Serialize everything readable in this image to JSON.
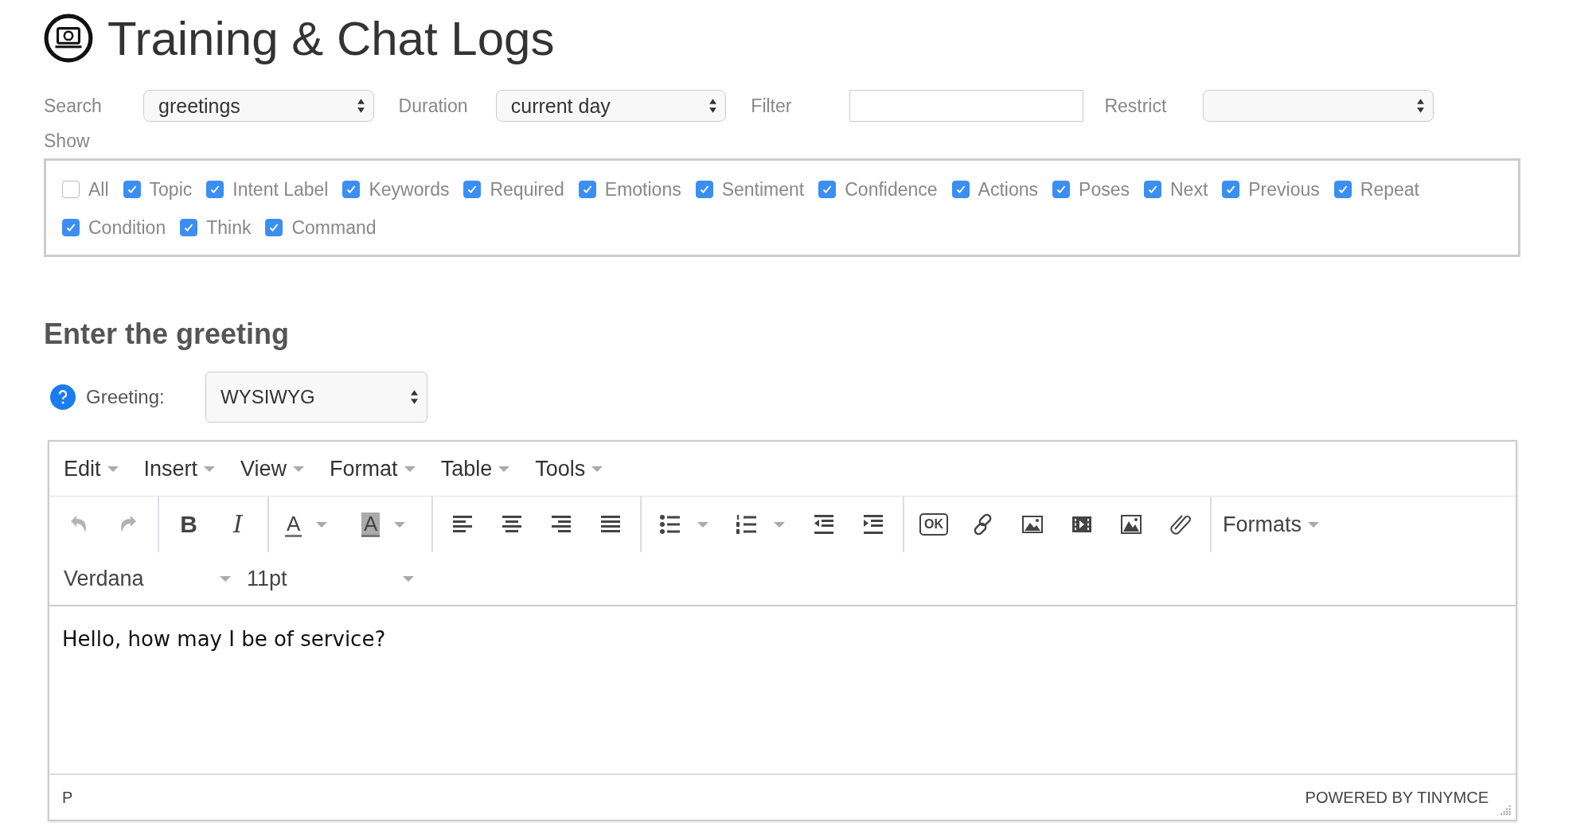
{
  "title": "Training & Chat Logs",
  "filters": [
    {
      "kind": "select",
      "label": "Search",
      "value": "greetings"
    },
    {
      "kind": "select",
      "label": "Duration",
      "value": "current day"
    },
    {
      "kind": "input",
      "label": "Filter"
    },
    {
      "kind": "select",
      "label": "Restrict"
    }
  ],
  "show": {
    "label": "Show",
    "options": [
      {
        "label": "All",
        "checked": false
      },
      {
        "label": "Topic",
        "checked": true
      },
      {
        "label": "Intent Label",
        "checked": true
      },
      {
        "label": "Keywords",
        "checked": true
      },
      {
        "label": "Required",
        "checked": true
      },
      {
        "label": "Emotions",
        "checked": true
      },
      {
        "label": "Sentiment",
        "checked": true
      },
      {
        "label": "Confidence",
        "checked": true
      },
      {
        "label": "Actions",
        "checked": true
      },
      {
        "label": "Poses",
        "checked": true
      },
      {
        "label": "Next",
        "checked": true
      },
      {
        "label": "Previous",
        "checked": true
      },
      {
        "label": "Repeat",
        "checked": true
      },
      {
        "label": "Condition",
        "checked": true
      },
      {
        "label": "Think",
        "checked": true
      },
      {
        "label": "Command",
        "checked": true
      }
    ]
  },
  "section_heading": "Enter the greeting",
  "greeting": {
    "label": "Greeting:",
    "mode": "WYSIWYG"
  },
  "editor": {
    "menu": [
      "Edit",
      "Insert",
      "View",
      "Format",
      "Table",
      "Tools"
    ],
    "toolbar": [
      [
        {
          "kind": "undo",
          "disabled": true
        },
        {
          "kind": "redo",
          "disabled": true
        }
      ],
      [
        {
          "kind": "bold",
          "label": "B",
          "disabled": false
        },
        {
          "kind": "italic",
          "label": "I",
          "disabled": false
        }
      ],
      [
        {
          "kind": "forecolor",
          "label": "A",
          "disabled": false
        },
        {
          "kind": "backcolor",
          "label": "A",
          "disabled": false
        }
      ],
      [
        {
          "kind": "alignleft",
          "disabled": false
        },
        {
          "kind": "aligncenter",
          "disabled": false
        },
        {
          "kind": "alignright",
          "disabled": false
        },
        {
          "kind": "justify",
          "disabled": false
        }
      ],
      [
        {
          "kind": "bullist",
          "disabled": false
        },
        {
          "kind": "numlist",
          "disabled": false
        },
        {
          "kind": "outdent",
          "disabled": false
        },
        {
          "kind": "indent",
          "disabled": false
        }
      ],
      [
        {
          "kind": "ok",
          "label": "OK",
          "disabled": false
        },
        {
          "kind": "link",
          "disabled": false
        },
        {
          "kind": "image",
          "disabled": false
        },
        {
          "kind": "media",
          "disabled": false
        },
        {
          "kind": "picture",
          "disabled": false
        },
        {
          "kind": "attach",
          "disabled": false
        }
      ],
      [
        {
          "kind": "menu",
          "label": "Formats",
          "disabled": false
        }
      ]
    ],
    "font_family": "Verdana",
    "font_size": "11pt",
    "content": "Hello, how may I be of service?",
    "path": "P",
    "branding": "POWERED BY TINYMCE"
  }
}
